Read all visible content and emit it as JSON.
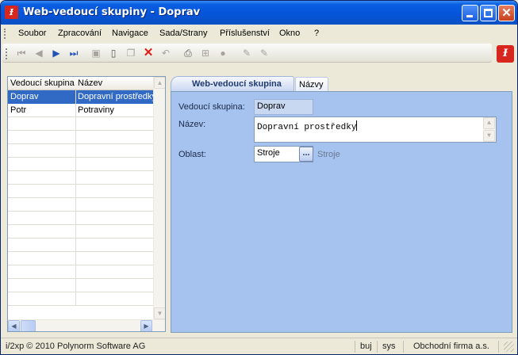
{
  "window": {
    "title": "Web-vedoucí skupiny - Doprav",
    "app_icon": "pn-logo-icon"
  },
  "menu": [
    "Soubor",
    "Zpracování",
    "Navigace",
    "Sada/Strany",
    "Příslušenství",
    "Okno",
    "?"
  ],
  "toolbar": {
    "icons": [
      "first-record-icon",
      "prev-record-icon",
      "next-record-icon",
      "last-record-icon",
      "save-icon",
      "new-icon",
      "copy-icon",
      "delete-icon",
      "undo-icon",
      "print-icon",
      "tree-icon",
      "refresh-icon",
      "edit-icon",
      "edit-alt-icon"
    ]
  },
  "grid": {
    "columns": [
      "Vedoucí skupina",
      "Název"
    ],
    "rows": [
      {
        "code": "Doprav",
        "name": "Dopravní prostředky",
        "selected": true
      },
      {
        "code": "Potr",
        "name": "Potraviny",
        "selected": false
      }
    ]
  },
  "tabs": [
    "Web-vedoucí skupina",
    "Názvy"
  ],
  "form": {
    "code_label": "Vedoucí skupina:",
    "code_value": "Doprav",
    "name_label": "Název:",
    "name_value": "Dopravní prostředky",
    "area_label": "Oblast:",
    "area_value": "Stroje",
    "area_button": "...",
    "area_description": "Stroje"
  },
  "status": {
    "copyright": "i/2xp © 2010 Polynorm Software AG",
    "lang": "buj",
    "user": "sys",
    "company": "Obchodní firma a.s."
  },
  "colors": {
    "titlebar": "#0553d8",
    "panel": "#a6c2ee",
    "selection": "#316ac5"
  }
}
